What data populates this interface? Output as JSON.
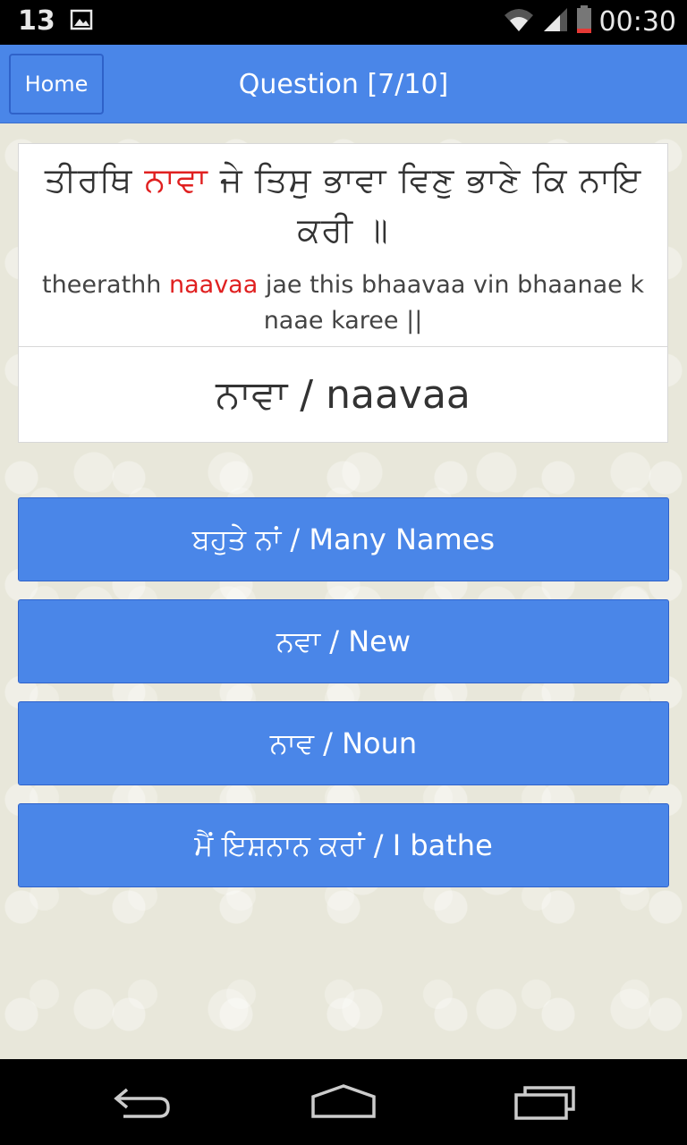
{
  "status_bar": {
    "notification_count": "13",
    "time": "00:30",
    "icons": [
      "image-icon",
      "wifi-icon",
      "signal-icon",
      "battery-icon"
    ]
  },
  "app_bar": {
    "home_label": "Home",
    "title": "Question [7/10]"
  },
  "question": {
    "gurmukhi_before": "ਤੀਰਥਿ ",
    "gurmukhi_highlight": "ਨਾਵਾ",
    "gurmukhi_after": " ਜੇ ਤਿਸੁ ਭਾਵਾ ਵਿਣੁ ਭਾਣੇ ਕਿ ਨਾਇ ਕਰੀ ॥",
    "translit_before": "theerathh ",
    "translit_highlight": "naavaa",
    "translit_after": " jae this bhaavaa vin bhaanae k naae karee ||",
    "target_word": "ਨਾਵਾ / naavaa",
    "highlight_color": "#e02020"
  },
  "answers": [
    {
      "label": "ਬਹੁਤੇ ਨਾਂ / Many Names"
    },
    {
      "label": "ਨਵਾ / New"
    },
    {
      "label": "ਨਾਵ / Noun"
    },
    {
      "label": "ਮੈਂ ਇਸ਼ਨਾਨ ਕਰਾਂ / I bathe"
    }
  ],
  "colors": {
    "accent": "#4a86e8",
    "status_bar": "#000000",
    "nav_bar": "#000000"
  },
  "nav_bar": {
    "icons": [
      "back-icon",
      "home-icon",
      "recents-icon"
    ]
  }
}
